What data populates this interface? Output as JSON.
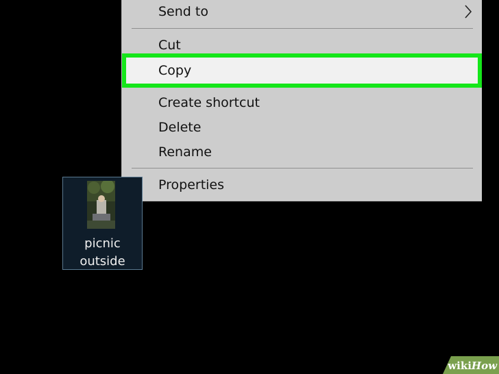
{
  "context_menu": {
    "items": [
      {
        "label": "Send to",
        "has_submenu": true
      },
      {
        "label": "Cut"
      },
      {
        "label": "Copy",
        "highlighted": true
      },
      {
        "label": "Create shortcut"
      },
      {
        "label": "Delete"
      },
      {
        "label": "Rename"
      },
      {
        "label": "Properties"
      }
    ],
    "highlight_color": "#15e61a",
    "background_color": "#cdcdcd"
  },
  "desktop_icon": {
    "label_line1": "picnic",
    "label_line2": "outside",
    "selected": true
  },
  "watermark": {
    "text_wiki": "wiki",
    "text_how": "How"
  }
}
